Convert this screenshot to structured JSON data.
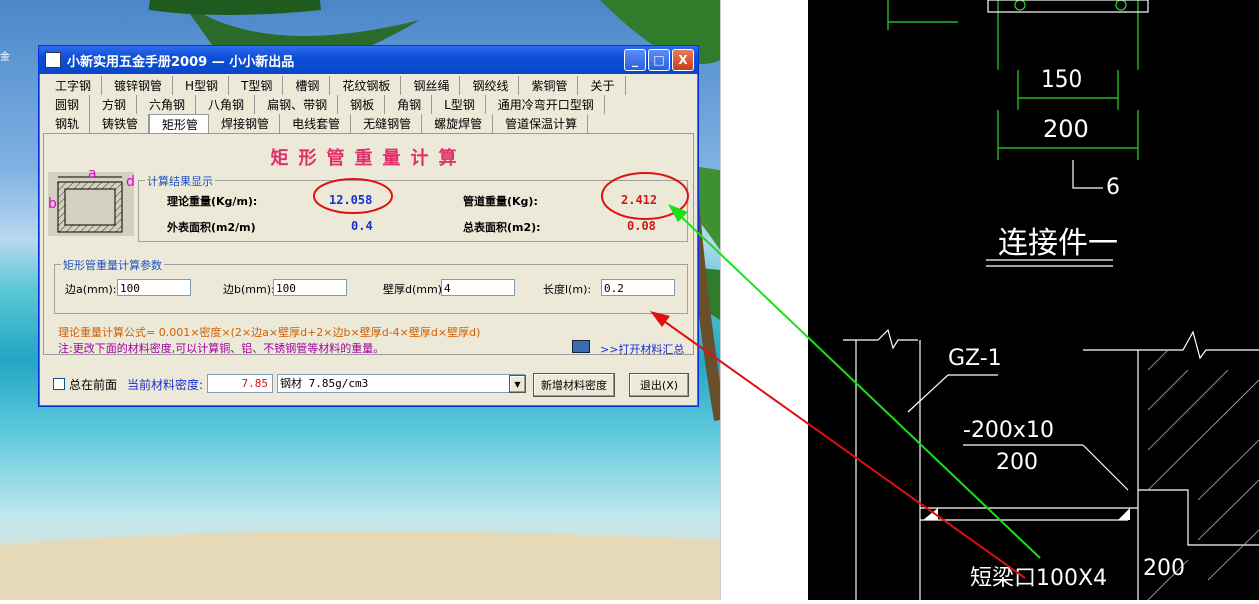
{
  "desktop": {
    "icon_label": "金"
  },
  "window": {
    "title": "小新实用五金手册2009 — 小小新出品",
    "controls": {
      "minimize": "_",
      "maximize": "□",
      "close": "X"
    }
  },
  "tabs": {
    "row1": [
      "工字钢",
      "镀锌钢管",
      "H型钢",
      "T型钢",
      "槽钢",
      "花纹钢板",
      "钢丝绳",
      "钢绞线",
      "紫铜管",
      "关于"
    ],
    "row2": [
      "圆钢",
      "方钢",
      "六角钢",
      "八角钢",
      "扁钢、带钢",
      "钢板",
      "角钢",
      "L型钢",
      "通用冷弯开口型钢"
    ],
    "row3": [
      "钢轨",
      "铸铁管",
      "矩形管",
      "焊接钢管",
      "电线套管",
      "无缝钢管",
      "螺旋焊管",
      "管道保温计算"
    ],
    "active": "矩形管"
  },
  "panel": {
    "heading": "矩形管重量计算",
    "diagram_labels": {
      "a": "a",
      "b": "b",
      "d": "d"
    },
    "results": {
      "group_label": "计算结果显示",
      "theory_weight_label": "理论重量(Kg/m):",
      "theory_weight_value": "12.058",
      "pipe_weight_label": "管道重量(Kg):",
      "pipe_weight_value": "2.412",
      "outer_area_label": "外表面积(m2/m)",
      "outer_area_value": "0.4",
      "total_area_label": "总表面积(m2):",
      "total_area_value": "0.08"
    },
    "params": {
      "group_label": "矩形管重量计算参数",
      "side_a_label": "边a(mm):",
      "side_a_value": "100",
      "side_b_label": "边b(mm):",
      "side_b_value": "100",
      "thickness_label": "壁厚d(mm)",
      "thickness_value": "4",
      "length_label": "长度l(m):",
      "length_value": "0.2"
    },
    "formula": "理论重量计算公式= 0.001×密度×(2×边a×壁厚d+2×边b×壁厚d-4×壁厚d×壁厚d)",
    "note": "注:更改下面的材料密度,可以计算铜、铝、不锈钢管等材料的重量。",
    "open_materials": ">>打开材料汇总"
  },
  "footer": {
    "always_on_top_label": "总在前面",
    "density_label": "当前材料密度:",
    "density_value": "7.85",
    "material_select": "钢材 7.85g/cm3",
    "add_density_button": "新增材料密度",
    "exit_button": "退出(X)"
  },
  "cad": {
    "dim_150": "150",
    "dim_200_top": "200",
    "callout_6": "6",
    "connector_title": "连接件一",
    "gz_label": "GZ-1",
    "plate_label": "-200x10",
    "plate_dim": "200",
    "beam_label": "短梁口100X4",
    "dim_200_bottom": "200"
  },
  "colors": {
    "heading": "#e0306a",
    "theory_value": "#1a2fd0",
    "pipe_value": "#d01818",
    "annotation_red": "#e01010",
    "annotation_green": "#19e019"
  }
}
